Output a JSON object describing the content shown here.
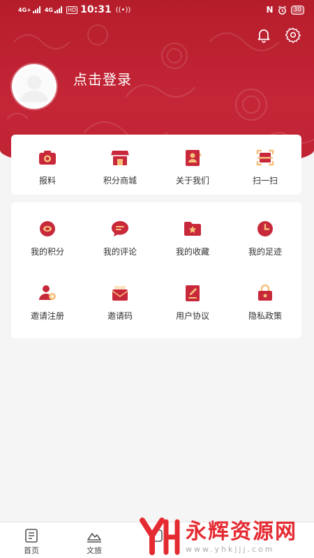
{
  "status_bar": {
    "signal1": "4G+",
    "signal2": "4G",
    "hd": "HD",
    "time": "10:31",
    "nfc": "N",
    "battery": "30"
  },
  "header": {
    "login_text": "点击登录",
    "icons": [
      "bell-icon",
      "gear-icon"
    ]
  },
  "quick_actions": [
    {
      "label": "报料",
      "icon": "camera-icon"
    },
    {
      "label": "积分商城",
      "icon": "store-icon"
    },
    {
      "label": "关于我们",
      "icon": "contact-card-icon"
    },
    {
      "label": "扫一扫",
      "icon": "scan-icon"
    }
  ],
  "menu": [
    {
      "label": "我的积分",
      "icon": "points-icon"
    },
    {
      "label": "我的评论",
      "icon": "comment-icon"
    },
    {
      "label": "我的收藏",
      "icon": "favorite-folder-icon"
    },
    {
      "label": "我的足迹",
      "icon": "clock-icon"
    },
    {
      "label": "邀请注册",
      "icon": "invite-user-icon"
    },
    {
      "label": "邀请码",
      "icon": "envelope-heart-icon"
    },
    {
      "label": "用户协议",
      "icon": "agreement-icon"
    },
    {
      "label": "隐私政策",
      "icon": "lock-icon"
    }
  ],
  "tabbar": [
    {
      "label": "首页",
      "icon": "newspaper-icon"
    },
    {
      "label": "文旅",
      "icon": "mountain-icon"
    },
    {
      "label": "",
      "icon": "tab3-icon"
    }
  ],
  "watermark": {
    "title": "永辉资源网",
    "url": "www.yhkjjj.com"
  },
  "colors": {
    "brand_red": "#c42637",
    "icon_red": "#c8293a",
    "background": "#f5f5f5"
  }
}
